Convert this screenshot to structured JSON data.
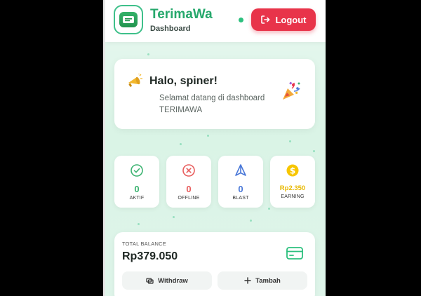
{
  "header": {
    "app_title": "TerimaWa",
    "subtitle": "Dashboard",
    "logout_label": "Logout"
  },
  "greeting": {
    "title": "Halo, spiner!",
    "line1": "Selamat datang di dashboard",
    "line2": "TERIMAWA"
  },
  "stats": [
    {
      "value": "0",
      "label": "AKTIF",
      "icon": "check-circle-icon",
      "color": "#3cb371"
    },
    {
      "value": "0",
      "label": "OFFLINE",
      "icon": "x-circle-icon",
      "color": "#e85d5d"
    },
    {
      "value": "0",
      "label": "BLAST",
      "icon": "send-icon",
      "color": "#4a78d8"
    },
    {
      "value": "Rp2.350",
      "label": "EARNING",
      "icon": "dollar-circle-icon",
      "color": "#e8b800"
    }
  ],
  "balance": {
    "label": "TOTAL BALANCE",
    "amount": "Rp379.050",
    "withdraw_label": "Withdraw",
    "add_label": "Tambah"
  },
  "colors": {
    "brand": "#26a86c",
    "logout": "#e8344a"
  }
}
